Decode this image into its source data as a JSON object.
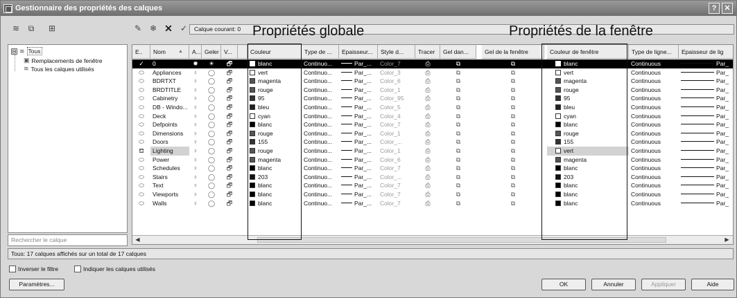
{
  "window": {
    "title": "Gestionnaire des propriétés des calques",
    "help_label": "?",
    "close_label": "✕"
  },
  "toolbar": {
    "current_layer": "Calque courant: 0"
  },
  "annotations": {
    "global": "Propriétés globale",
    "viewport": "Propriétés de la fenêtre"
  },
  "tree": {
    "root_expander": "⊟",
    "root": "Tous",
    "children": [
      "Remplacements de fenêtre",
      "Tous les calques utilisés"
    ]
  },
  "search": {
    "placeholder": "Rechercher le calque"
  },
  "columns": [
    "E..",
    "Nom",
    "A...",
    "Geler",
    "V...",
    "Couleur",
    "Type de ...",
    "Epaisseur...",
    "Style d...",
    "Tracer",
    "Gel dan...",
    "Gel de la fenêtre",
    "Couleur de fenêtre",
    "Type de ligne...",
    "Epaisseur de lig"
  ],
  "sort_indicator": "▲",
  "current_marker": "✓",
  "lineweight_text": "Par_...",
  "viewport_lineweight_text": "Par_",
  "rows": [
    {
      "name": "0",
      "color": "blanc",
      "linetype": "Continuo...",
      "plotstyle": "Color_7",
      "vp_color": "blanc",
      "vp_linetype": "Continuous",
      "swatch": "#ffffff",
      "vp_swatch": "#ffffff"
    },
    {
      "name": "Appliances",
      "color": "vert",
      "linetype": "Continuo...",
      "plotstyle": "Color_3",
      "vp_color": "vert",
      "vp_linetype": "Continuous",
      "swatch": "#ffffff",
      "vp_swatch": "#ffffff"
    },
    {
      "name": "BDRTXT",
      "color": "magenta",
      "linetype": "Continuo...",
      "plotstyle": "Color_6",
      "vp_color": "magenta",
      "vp_linetype": "Continuous",
      "swatch": "#555555",
      "vp_swatch": "#555555"
    },
    {
      "name": "BRDTITLE",
      "color": "rouge",
      "linetype": "Continuo...",
      "plotstyle": "Color_1",
      "vp_color": "rouge",
      "vp_linetype": "Continuous",
      "swatch": "#555555",
      "vp_swatch": "#555555"
    },
    {
      "name": "Cabinetry",
      "color": "95",
      "linetype": "Continuo...",
      "plotstyle": "Color_95",
      "vp_color": "95",
      "vp_linetype": "Continuous",
      "swatch": "#333333",
      "vp_swatch": "#333333"
    },
    {
      "name": "DB - Windo...",
      "color": "bleu",
      "linetype": "Continuo...",
      "plotstyle": "Color_5",
      "vp_color": "bleu",
      "vp_linetype": "Continuous",
      "swatch": "#222222",
      "vp_swatch": "#222222"
    },
    {
      "name": "Deck",
      "color": "cyan",
      "linetype": "Continuo...",
      "plotstyle": "Color_4",
      "vp_color": "cyan",
      "vp_linetype": "Continuous",
      "swatch": "#ffffff",
      "vp_swatch": "#ffffff"
    },
    {
      "name": "Defpoints",
      "color": "blanc",
      "linetype": "Continuo...",
      "plotstyle": "Color_7",
      "vp_color": "blanc",
      "vp_linetype": "Continuous",
      "swatch": "#000000",
      "vp_swatch": "#000000"
    },
    {
      "name": "Dimensions",
      "color": "rouge",
      "linetype": "Continuo...",
      "plotstyle": "Color_1",
      "vp_color": "rouge",
      "vp_linetype": "Continuous",
      "swatch": "#555555",
      "vp_swatch": "#555555"
    },
    {
      "name": "Doors",
      "color": "155",
      "linetype": "Continuo...",
      "plotstyle": "Color_...",
      "vp_color": "155",
      "vp_linetype": "Continuous",
      "swatch": "#333333",
      "vp_swatch": "#333333"
    },
    {
      "name": "Lighting",
      "color": "rouge",
      "linetype": "Continuo...",
      "plotstyle": "Color_1",
      "vp_color": "vert",
      "vp_linetype": "Continuous",
      "swatch": "#555555",
      "vp_swatch": "#ffffff"
    },
    {
      "name": "Power",
      "color": "magenta",
      "linetype": "Continuo...",
      "plotstyle": "Color_6",
      "vp_color": "magenta",
      "vp_linetype": "Continuous",
      "swatch": "#555555",
      "vp_swatch": "#555555"
    },
    {
      "name": "Schedules",
      "color": "blanc",
      "linetype": "Continuo...",
      "plotstyle": "Color_7",
      "vp_color": "blanc",
      "vp_linetype": "Continuous",
      "swatch": "#000000",
      "vp_swatch": "#000000"
    },
    {
      "name": "Stairs",
      "color": "203",
      "linetype": "Continuo...",
      "plotstyle": "Color_...",
      "vp_color": "203",
      "vp_linetype": "Continuous",
      "swatch": "#111111",
      "vp_swatch": "#111111"
    },
    {
      "name": "Text",
      "color": "blanc",
      "linetype": "Continuo...",
      "plotstyle": "Color_7",
      "vp_color": "blanc",
      "vp_linetype": "Continuous",
      "swatch": "#000000",
      "vp_swatch": "#000000"
    },
    {
      "name": "Viewports",
      "color": "blanc",
      "linetype": "Continuo...",
      "plotstyle": "Color_7",
      "vp_color": "blanc",
      "vp_linetype": "Continuous",
      "swatch": "#000000",
      "vp_swatch": "#000000"
    },
    {
      "name": "Walls",
      "color": "blanc",
      "linetype": "Continuo...",
      "plotstyle": "Color_7",
      "vp_color": "blanc",
      "vp_linetype": "Continuous",
      "swatch": "#000000",
      "vp_swatch": "#000000"
    }
  ],
  "status": "Tous: 17 calques affichés sur un total de 17 calques",
  "options": {
    "invert_filter": "Inverser le filtre",
    "indicate_used": "Indiquer les calques utilisés"
  },
  "buttons": {
    "settings": "Paramètres...",
    "ok": "OK",
    "cancel": "Annuler",
    "apply": "Appliquer",
    "help": "Aide"
  }
}
